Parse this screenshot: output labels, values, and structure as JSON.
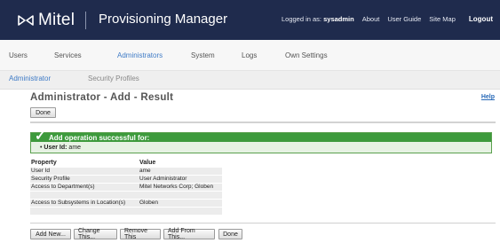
{
  "header": {
    "brand": "Mitel",
    "app_title": "Provisioning Manager",
    "logged_in_prefix": "Logged in as:",
    "logged_in_user": "sysadmin",
    "links": [
      "About",
      "User Guide",
      "Site Map"
    ],
    "logout": "Logout"
  },
  "main_nav": {
    "items": [
      "Users",
      "Services",
      "Administrators",
      "System",
      "Logs",
      "Own Settings"
    ],
    "active": "Administrators"
  },
  "sub_nav": {
    "items": [
      "Administrator",
      "Security Profiles"
    ],
    "active": "Administrator"
  },
  "page": {
    "title": "Administrator - Add - Result",
    "help": "Help",
    "done_top": "Done"
  },
  "success": {
    "heading": "Add operation successful for:",
    "detail_label": "User Id:",
    "detail_value": "ame"
  },
  "table": {
    "columns": [
      "Property",
      "Value"
    ],
    "rows": [
      [
        "User Id",
        "ame"
      ],
      [
        "Security Profile",
        "User Administrator"
      ],
      [
        "Access to Department(s)",
        "Mitel Networks Corp; Globen"
      ],
      [
        "",
        ""
      ],
      [
        "Access to Subsystems in Location(s)",
        "Globen"
      ],
      [
        "",
        ""
      ]
    ]
  },
  "actions": [
    "Add New...",
    "Change This...",
    "Remove This",
    "Add From This...",
    "Done"
  ],
  "colors": {
    "header_bg": "#1f2b4d",
    "accent": "#3f7bc6",
    "success_green": "#3d9a3c"
  }
}
